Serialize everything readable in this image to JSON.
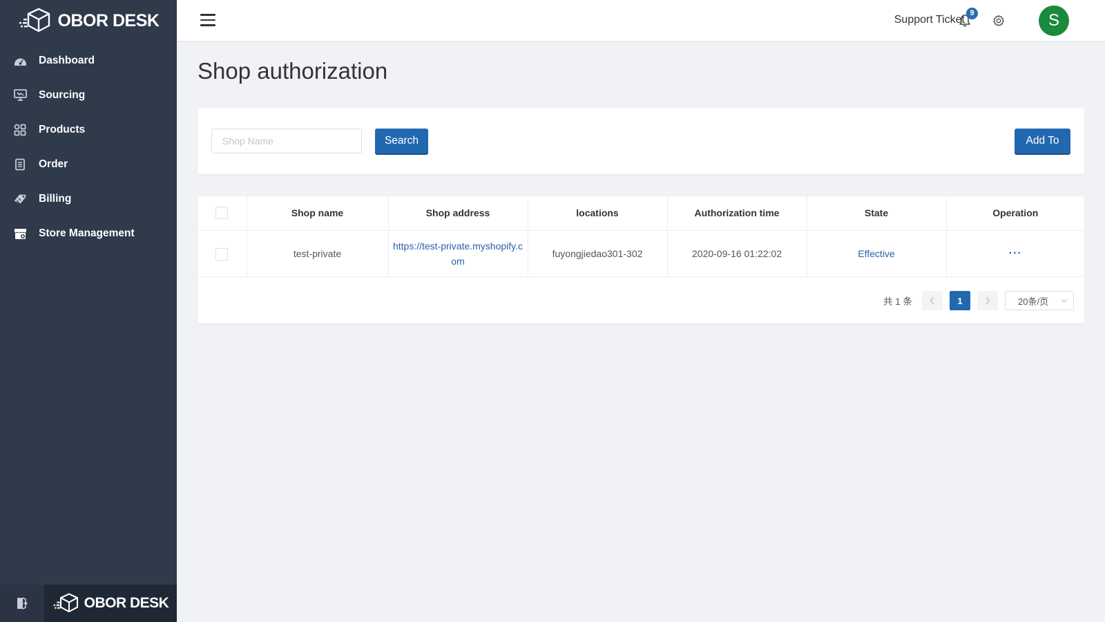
{
  "brand": {
    "name": "OBOR DESK"
  },
  "sidebar": {
    "items": [
      {
        "label": "Dashboard",
        "icon": "dashboard-icon"
      },
      {
        "label": "Sourcing",
        "icon": "sourcing-icon"
      },
      {
        "label": "Products",
        "icon": "products-icon"
      },
      {
        "label": "Order",
        "icon": "order-icon"
      },
      {
        "label": "Billing",
        "icon": "billing-icon"
      },
      {
        "label": "Store Management",
        "icon": "store-icon"
      }
    ]
  },
  "header": {
    "support_label": "Support Ticket",
    "notification_count": "9",
    "avatar_letter": "S"
  },
  "page": {
    "title": "Shop authorization"
  },
  "search": {
    "placeholder": "Shop Name",
    "value": "",
    "search_label": "Search",
    "add_label": "Add To"
  },
  "table": {
    "columns": [
      "Shop name",
      "Shop address",
      "locations",
      "Authorization time",
      "State",
      "Operation"
    ],
    "rows": [
      {
        "shop_name": "test-private",
        "shop_address": "https://test-private.myshopify.com",
        "location": "fuyongjiedao301-302",
        "auth_time": "2020-09-16 01:22:02",
        "state": "Effective",
        "operation": "···"
      }
    ]
  },
  "pagination": {
    "total_text": "共 1 条",
    "current_page": "1",
    "page_size": "20条/页"
  },
  "colors": {
    "sidebar": "#2f3a4b",
    "primary": "#2268b0",
    "avatar": "#1a8a3d",
    "link": "#2b5fa6",
    "background": "#f0f2f5"
  }
}
